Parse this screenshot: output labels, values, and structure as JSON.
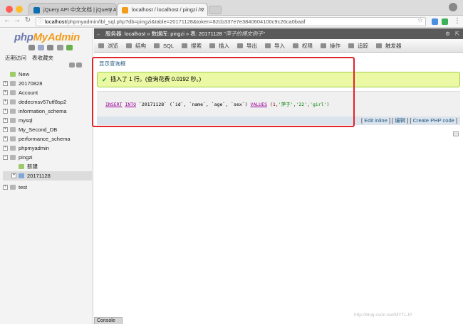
{
  "browser": {
    "tabs": [
      {
        "title": "jQuery API 中文文档 | jQuery A",
        "active": false
      },
      {
        "title": "localhost / localhost / pingzi / 2",
        "active": true
      }
    ],
    "url": {
      "host": "localhost",
      "path": "/phpmyadmin/tbl_sql.php?db=pingzi&table=20171128&token=82cb337e7e3840604100c9c26ca0baaf"
    },
    "colors": {
      "red": "#ff5f57",
      "yellow": "#ffbd2e",
      "green": "#28c940"
    }
  },
  "sidebar": {
    "logo": {
      "php": "php",
      "my": "MyAdmin"
    },
    "tabs": [
      "近期访问",
      "表收藏夹"
    ],
    "tree": [
      {
        "label": "New",
        "type": "new"
      },
      {
        "label": "20170828",
        "type": "db"
      },
      {
        "label": "Account",
        "type": "db"
      },
      {
        "label": "dedecmsv57utf8sp2",
        "type": "db"
      },
      {
        "label": "information_schema",
        "type": "db"
      },
      {
        "label": "mysql",
        "type": "db"
      },
      {
        "label": "My_Second_DB",
        "type": "db"
      },
      {
        "label": "performance_schema",
        "type": "db"
      },
      {
        "label": "phpmyadmin",
        "type": "db"
      },
      {
        "label": "pingzi",
        "type": "db",
        "expanded": true
      },
      {
        "label": "新建",
        "type": "new-child"
      },
      {
        "label": "20171128",
        "type": "table",
        "selected": true
      },
      {
        "label": "test",
        "type": "db"
      }
    ]
  },
  "main": {
    "breadcrumb": {
      "server": "服务器: localhost",
      "database": "数据库: pingzi",
      "table": "表: 20171128",
      "comment": "\"萍子的博文例子\""
    },
    "menu": [
      "浏览",
      "结构",
      "SQL",
      "搜索",
      "插入",
      "导出",
      "导入",
      "权限",
      "操作",
      "追踪",
      "触发器"
    ],
    "query_title": "显示查询框",
    "success_message": "插入了 1 行。(查询花费 0.0192 秒。)",
    "sql": {
      "kw_insert": "INSERT",
      "kw_into": "INTO",
      "table": "`20171128`",
      "cols": "(`id`, `name`, `age`, `sex`)",
      "kw_values": "VALUES",
      "values_open": "(1,",
      "name_value": "'萍子'",
      "age_value": "'22'",
      "sex_value": "'girl'",
      "values_close": ")"
    },
    "sql_actions": {
      "edit_inline": "Edit inline",
      "edit": "编辑",
      "create_php": "Create PHP code"
    },
    "console_label": "Console",
    "watermark": "http://blog.csdn.net/MYTLJP"
  }
}
